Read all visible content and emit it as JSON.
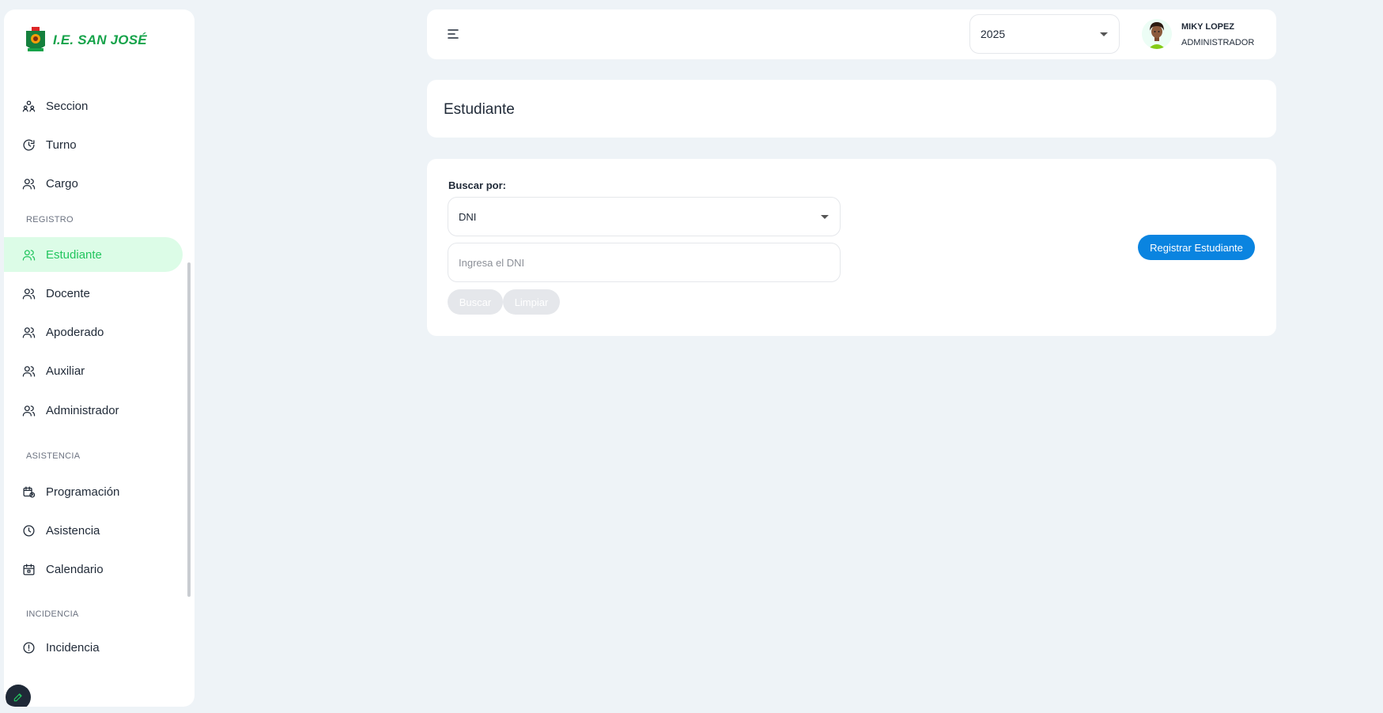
{
  "brand": {
    "name": "I.E. SAN JOSÉ",
    "color": "#16a34a"
  },
  "sidebar": {
    "items_top": [
      {
        "label": "Seccion",
        "icon": "users-group-icon"
      },
      {
        "label": "Turno",
        "icon": "clock-refresh-icon"
      },
      {
        "label": "Cargo",
        "icon": "users-icon"
      }
    ],
    "section_registro": "REGISTRO",
    "items_registro": [
      {
        "label": "Estudiante",
        "icon": "users-icon",
        "active": true
      },
      {
        "label": "Docente",
        "icon": "users-icon"
      },
      {
        "label": "Apoderado",
        "icon": "users-icon"
      },
      {
        "label": "Auxiliar",
        "icon": "users-icon"
      },
      {
        "label": "Administrador",
        "icon": "users-icon"
      }
    ],
    "section_asistencia": "ASISTENCIA",
    "items_asistencia": [
      {
        "label": "Programación",
        "icon": "calendar-clock-icon"
      },
      {
        "label": "Asistencia",
        "icon": "clock-icon"
      },
      {
        "label": "Calendario",
        "icon": "calendar-icon"
      }
    ],
    "section_incidencia": "INCIDENCIA",
    "items_incidencia": [
      {
        "label": "Incidencia",
        "icon": "alert-icon"
      }
    ]
  },
  "header": {
    "year": "2025",
    "user_name": "MIKY LOPEZ",
    "user_role": "ADMINISTRADOR"
  },
  "page": {
    "title": "Estudiante"
  },
  "search": {
    "label": "Buscar por:",
    "type_value": "DNI",
    "placeholder": "Ingresa el DNI",
    "buscar_label": "Buscar",
    "limpiar_label": "Limpiar",
    "register_label": "Registrar Estudiante"
  },
  "colors": {
    "accent": "#22c55e",
    "active_bg": "#dcfce7",
    "primary": "#0a84e0",
    "background": "#eef3f7"
  }
}
